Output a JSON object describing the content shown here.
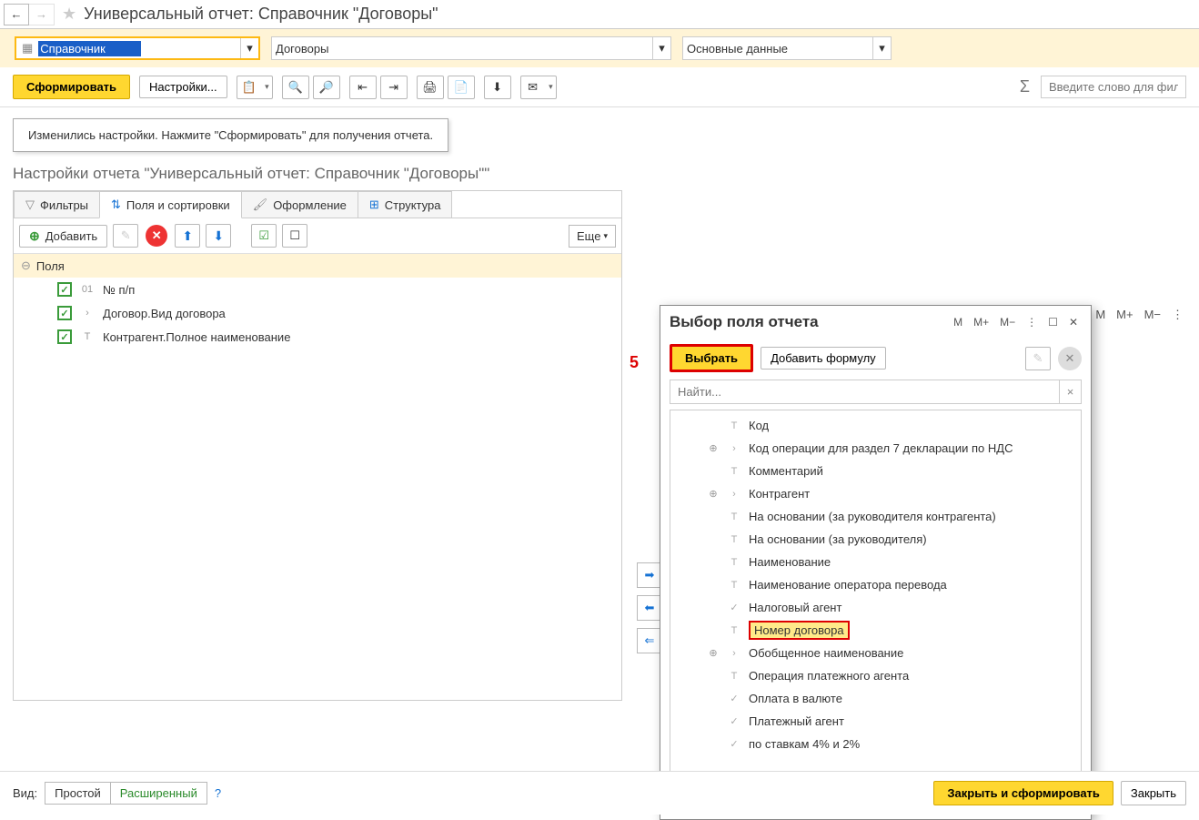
{
  "title": "Универсальный отчет: Справочник \"Договоры\"",
  "selectors": {
    "type": "Справочник",
    "object": "Договоры",
    "variant": "Основные данные"
  },
  "toolbar": {
    "generate": "Сформировать",
    "settings": "Настройки..."
  },
  "search_placeholder": "Введите слово для фил",
  "notice": "Изменились настройки. Нажмите \"Сформировать\" для получения отчета.",
  "settings_title": "Настройки отчета \"Универсальный отчет: Справочник \"Договоры\"\"",
  "tabs": {
    "filters": "Фильтры",
    "fields": "Поля и сортировки",
    "format": "Оформление",
    "structure": "Структура"
  },
  "panel": {
    "add": "Добавить",
    "more": "Еще"
  },
  "fields": {
    "header": "Поля",
    "rows": [
      {
        "type": "01",
        "label": "№ п/п"
      },
      {
        "type": "›",
        "label": "Договор.Вид договора"
      },
      {
        "type": "T",
        "label": "Контрагент.Полное наименование"
      }
    ]
  },
  "dialog": {
    "title": "Выбор поля отчета",
    "select": "Выбрать",
    "add_formula": "Добавить формулу",
    "search_placeholder": "Найти...",
    "items": [
      {
        "exp": "",
        "icon": "T",
        "label": "Код"
      },
      {
        "exp": "⊕",
        "icon": "›",
        "label": "Код операции для раздел 7 декларации по НДС"
      },
      {
        "exp": "",
        "icon": "T",
        "label": "Комментарий"
      },
      {
        "exp": "⊕",
        "icon": "›",
        "label": "Контрагент"
      },
      {
        "exp": "",
        "icon": "T",
        "label": "На основании (за руководителя контрагента)"
      },
      {
        "exp": "",
        "icon": "T",
        "label": "На основании (за руководителя)"
      },
      {
        "exp": "",
        "icon": "T",
        "label": "Наименование"
      },
      {
        "exp": "",
        "icon": "T",
        "label": "Наименование оператора перевода"
      },
      {
        "exp": "",
        "icon": "✓",
        "label": "Налоговый агент"
      },
      {
        "exp": "",
        "icon": "T",
        "label": "Номер договора",
        "hl": true
      },
      {
        "exp": "⊕",
        "icon": "›",
        "label": "Обобщенное наименование"
      },
      {
        "exp": "",
        "icon": "T",
        "label": "Операция платежного агента"
      },
      {
        "exp": "",
        "icon": "✓",
        "label": "Оплата в валюте"
      },
      {
        "exp": "",
        "icon": "✓",
        "label": "Платежный агент"
      },
      {
        "exp": "",
        "icon": "✓",
        "label": "по ставкам 4% и 2%"
      }
    ]
  },
  "footer": {
    "view": "Вид:",
    "simple": "Простой",
    "extended": "Расширенный",
    "close_gen": "Закрыть и сформировать",
    "close": "Закрыть"
  }
}
